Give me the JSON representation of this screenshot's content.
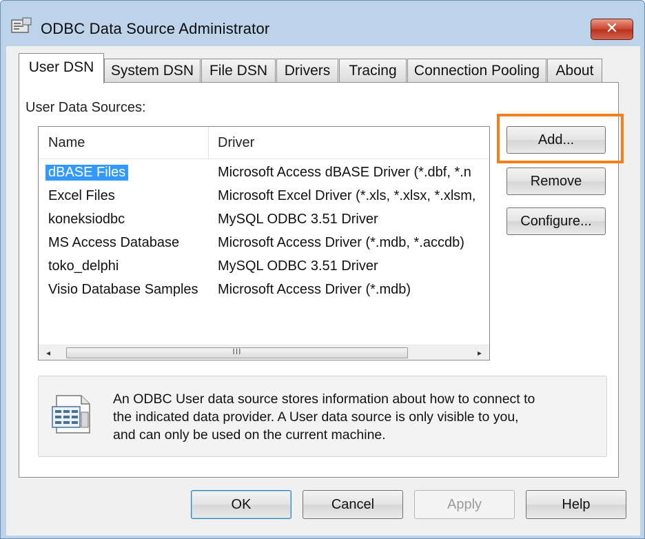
{
  "window": {
    "title": "ODBC Data Source Administrator",
    "close_label": "✕",
    "accent_highlight_color": "#f0821e",
    "selection_color": "#3399ff"
  },
  "tabs": [
    {
      "label": "User DSN",
      "active": true
    },
    {
      "label": "System DSN",
      "active": false
    },
    {
      "label": "File DSN",
      "active": false
    },
    {
      "label": "Drivers",
      "active": false
    },
    {
      "label": "Tracing",
      "active": false
    },
    {
      "label": "Connection Pooling",
      "active": false
    },
    {
      "label": "About",
      "active": false
    }
  ],
  "panel": {
    "section_label": "User Data Sources:",
    "columns": {
      "name": "Name",
      "driver": "Driver"
    },
    "rows": [
      {
        "name": "dBASE Files",
        "driver": "Microsoft Access dBASE Driver (*.dbf, *.n",
        "selected": true
      },
      {
        "name": "Excel Files",
        "driver": "Microsoft Excel Driver (*.xls, *.xlsx, *.xlsm,",
        "selected": false
      },
      {
        "name": "koneksiodbc",
        "driver": "MySQL ODBC 3.51 Driver",
        "selected": false
      },
      {
        "name": "MS Access Database",
        "driver": "Microsoft Access Driver (*.mdb, *.accdb)",
        "selected": false
      },
      {
        "name": "toko_delphi",
        "driver": "MySQL ODBC 3.51 Driver",
        "selected": false
      },
      {
        "name": "Visio Database Samples",
        "driver": "Microsoft Access Driver (*.mdb)",
        "selected": false
      }
    ],
    "scrollbar": {
      "left_arrow": "◂",
      "right_arrow": "▸",
      "grip": "III"
    },
    "buttons": {
      "add": "Add...",
      "remove": "Remove",
      "configure": "Configure..."
    },
    "info_lines": [
      "An ODBC User data source stores information about how to connect to",
      "the indicated data provider.   A User data source is only visible to you,",
      "and can only be used on the current machine."
    ]
  },
  "footer": {
    "ok": "OK",
    "cancel": "Cancel",
    "apply": "Apply",
    "help": "Help"
  }
}
